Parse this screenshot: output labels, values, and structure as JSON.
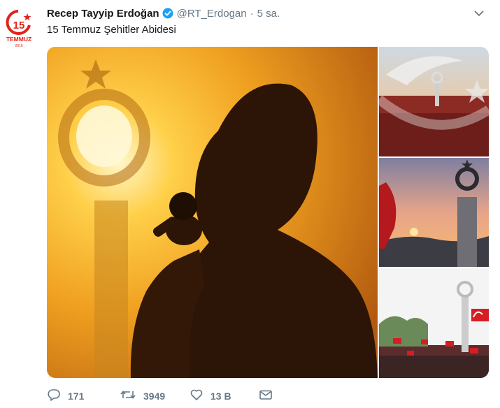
{
  "tweet": {
    "author_name": "Recep Tayyip Erdoğan",
    "handle": "@RT_Erdogan",
    "separator": "·",
    "time": "5 sa.",
    "text": "15 Temmuz Şehitler Abidesi",
    "verified": true
  },
  "avatar": {
    "label": "TEMMUZ",
    "number": "15",
    "year": "2016"
  },
  "actions": {
    "reply_count": "171",
    "retweet_count": "3949",
    "like_count": "13 B"
  },
  "colors": {
    "verified_blue": "#1da1f2",
    "muted": "#657786",
    "text": "#14171a",
    "avatar_red": "#e2231a"
  },
  "icons": {
    "verified": "verified-badge-icon",
    "caret": "chevron-down-icon",
    "reply": "reply-icon",
    "retweet": "retweet-icon",
    "like": "heart-icon",
    "dm": "envelope-icon"
  }
}
